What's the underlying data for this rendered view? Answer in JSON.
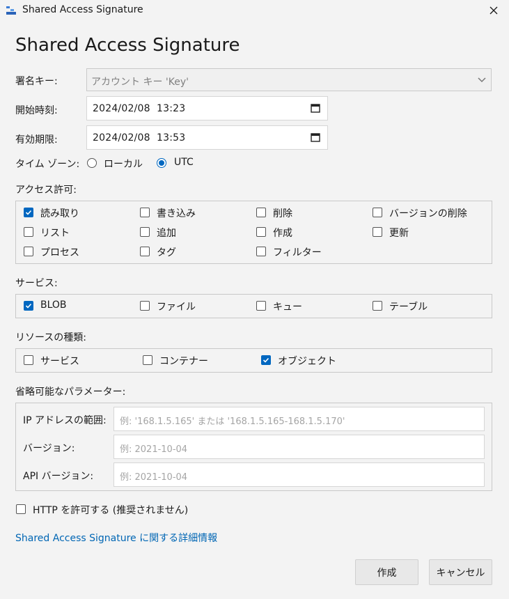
{
  "window": {
    "title": "Shared Access Signature"
  },
  "heading": "Shared Access Signature",
  "signing_key": {
    "label": "署名キー:",
    "value": "アカウント キー 'Key'"
  },
  "start_time": {
    "label": "開始時刻:",
    "date": "2024/02/08",
    "time": "13:23"
  },
  "expiry_time": {
    "label": "有効期限:",
    "date": "2024/02/08",
    "time": "13:53"
  },
  "timezone": {
    "label": "タイム ゾーン:",
    "options": [
      "ローカル",
      "UTC"
    ],
    "selected": "UTC"
  },
  "permissions": {
    "label": "アクセス許可:",
    "items": [
      {
        "label": "読み取り",
        "checked": true
      },
      {
        "label": "書き込み",
        "checked": false
      },
      {
        "label": "削除",
        "checked": false
      },
      {
        "label": "バージョンの削除",
        "checked": false
      },
      {
        "label": "リスト",
        "checked": false
      },
      {
        "label": "追加",
        "checked": false
      },
      {
        "label": "作成",
        "checked": false
      },
      {
        "label": "更新",
        "checked": false
      },
      {
        "label": "プロセス",
        "checked": false
      },
      {
        "label": "タグ",
        "checked": false
      },
      {
        "label": "フィルター",
        "checked": false
      }
    ]
  },
  "services": {
    "label": "サービス:",
    "items": [
      {
        "label": "BLOB",
        "checked": true
      },
      {
        "label": "ファイル",
        "checked": false
      },
      {
        "label": "キュー",
        "checked": false
      },
      {
        "label": "テーブル",
        "checked": false
      }
    ]
  },
  "resource_types": {
    "label": "リソースの種類:",
    "items": [
      {
        "label": "サービス",
        "checked": false
      },
      {
        "label": "コンテナー",
        "checked": false
      },
      {
        "label": "オブジェクト",
        "checked": true
      }
    ]
  },
  "optional": {
    "label": "省略可能なパラメーター:",
    "ip_range": {
      "label": "IP アドレスの範囲:",
      "placeholder": "例: '168.1.5.165' または '168.1.5.165-168.1.5.170'"
    },
    "version": {
      "label": "バージョン:",
      "placeholder": "例: 2021-10-04"
    },
    "api_version": {
      "label": "API バージョン:",
      "placeholder": "例: 2021-10-04"
    }
  },
  "allow_http": {
    "label": "HTTP を許可する (推奨されません)",
    "checked": false
  },
  "learn_more": "Shared Access Signature に関する詳細情報",
  "buttons": {
    "create": "作成",
    "cancel": "キャンセル"
  },
  "colors": {
    "accent": "#0067c0",
    "link": "#0066b4"
  }
}
